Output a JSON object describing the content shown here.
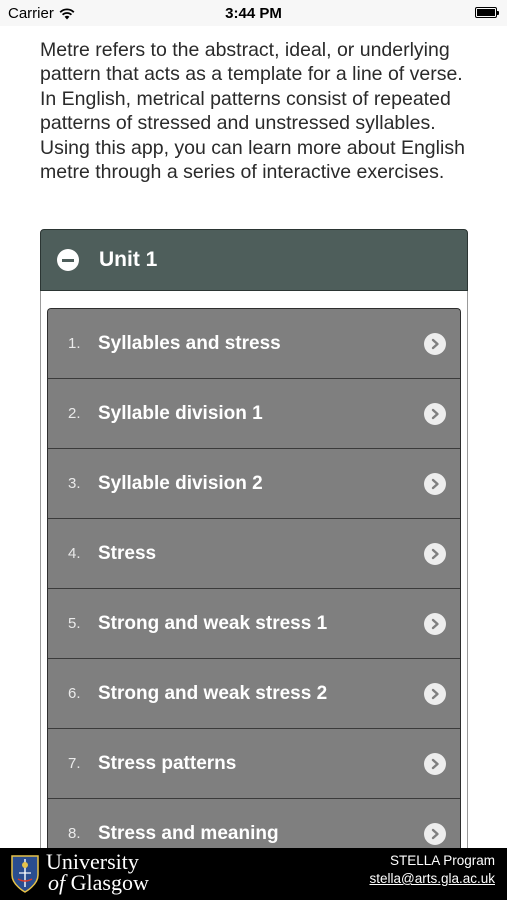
{
  "status_bar": {
    "carrier": "Carrier",
    "time": "3:44 PM"
  },
  "intro": "Metre refers to the abstract, ideal, or underlying pattern that acts as a template for a line of verse. In English, metrical patterns consist of repeated patterns of stressed and unstressed syllables. Using this app, you can learn more about English metre through a series of interactive exercises.",
  "unit": {
    "title": "Unit 1",
    "expanded": true
  },
  "lessons": [
    {
      "num": "1.",
      "label": "Syllables and stress"
    },
    {
      "num": "2.",
      "label": "Syllable division 1"
    },
    {
      "num": "3.",
      "label": "Syllable division 2"
    },
    {
      "num": "4.",
      "label": "Stress"
    },
    {
      "num": "5.",
      "label": "Strong and weak stress 1"
    },
    {
      "num": "6.",
      "label": "Strong and weak stress 2"
    },
    {
      "num": "7.",
      "label": "Stress patterns"
    },
    {
      "num": "8.",
      "label": "Stress and meaning"
    }
  ],
  "footer": {
    "university_line1": "University",
    "university_of": "of",
    "university_line2": "Glasgow",
    "program": "STELLA Program",
    "email": "stella@arts.gla.ac.uk"
  },
  "colors": {
    "unit_header": "#4e5e5b",
    "lesson_bg": "#7f7f7f",
    "footer_bg": "#000000"
  },
  "icons": {
    "wifi": "wifi-icon",
    "battery": "battery-icon",
    "collapse": "minus-circle-icon",
    "chevron": "chevron-right-circle-icon",
    "crest": "university-crest-icon"
  }
}
